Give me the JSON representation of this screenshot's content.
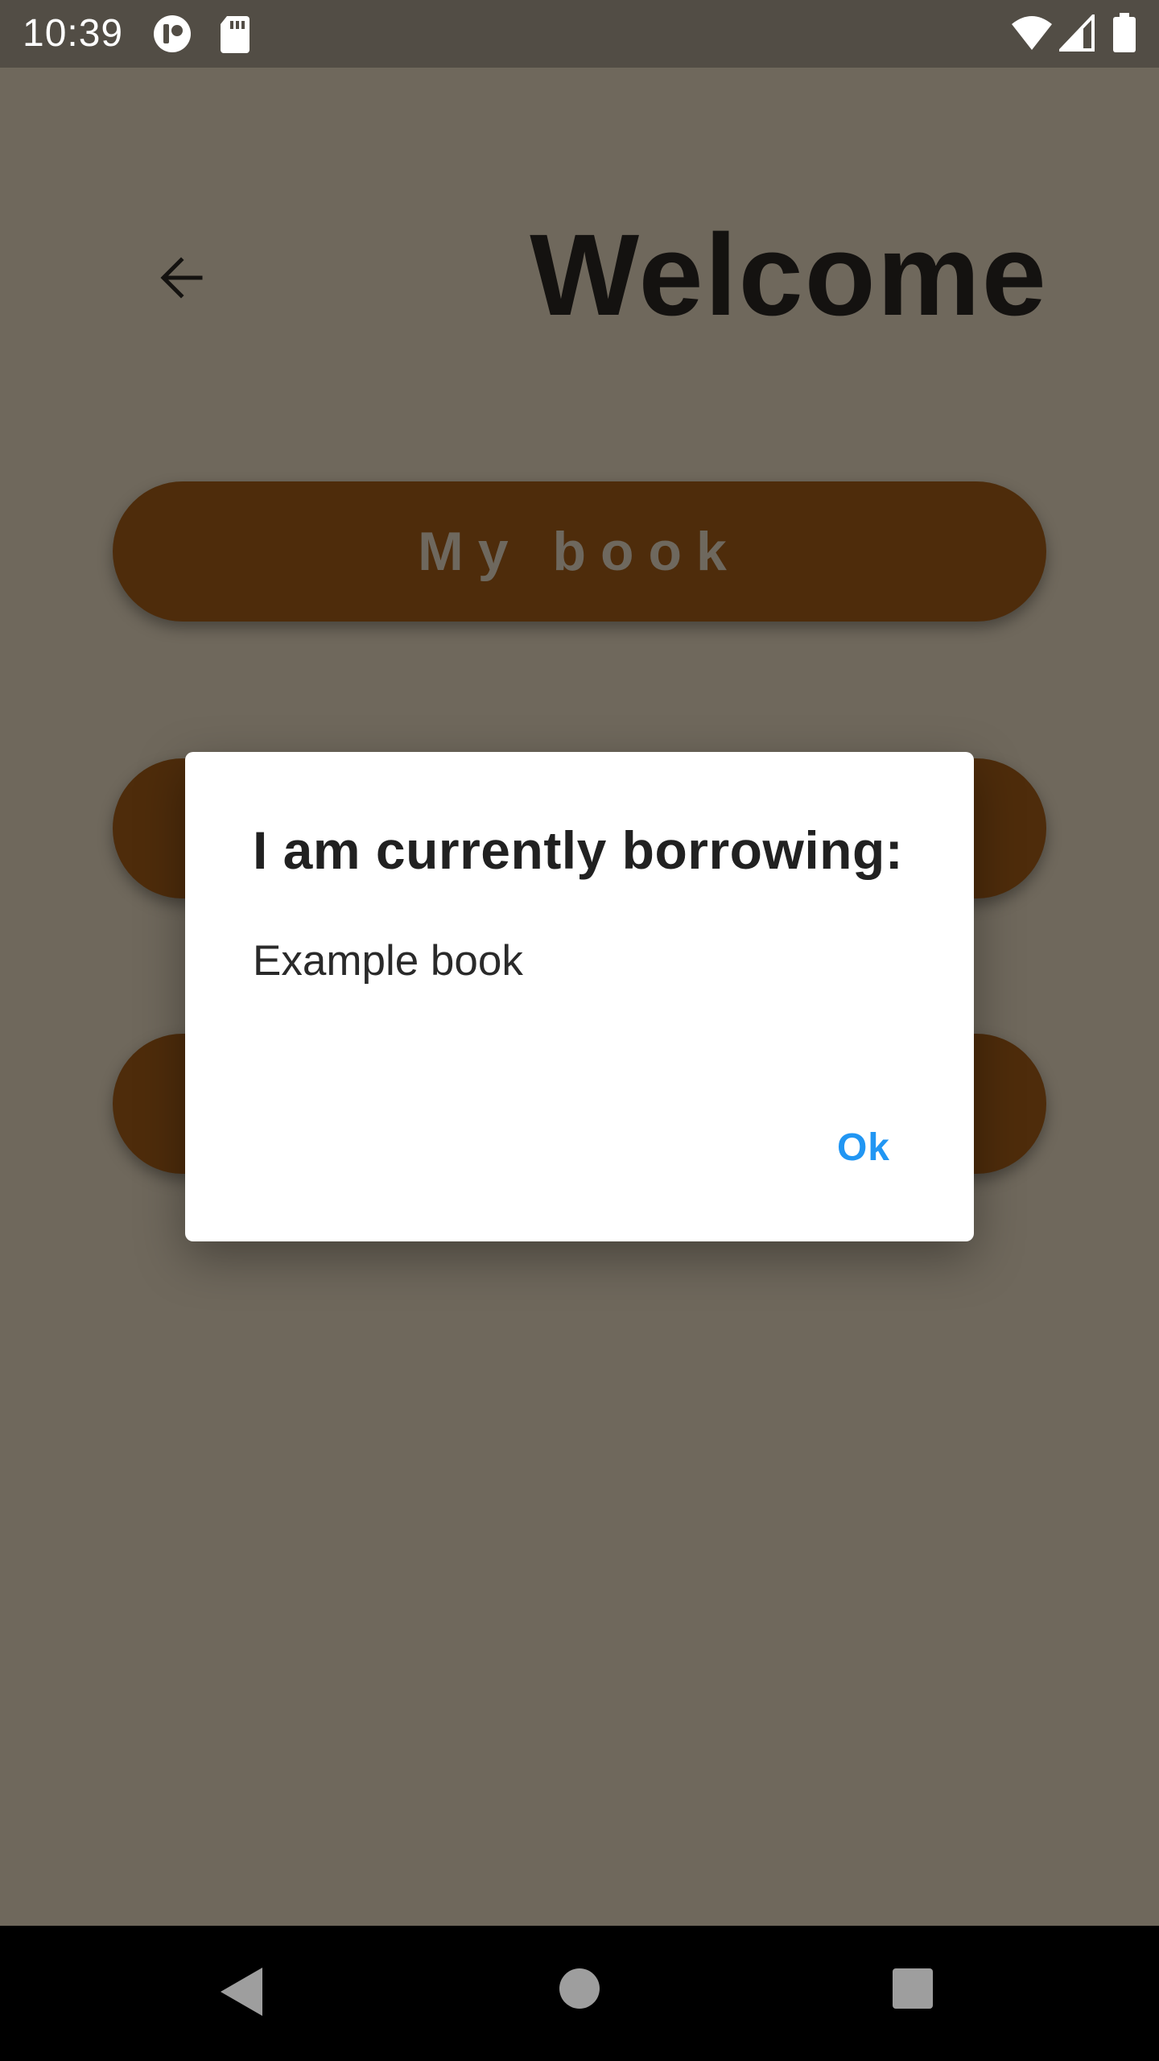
{
  "status_bar": {
    "time": "10:39",
    "icons": [
      "app-notification-icon",
      "sd-card-icon",
      "wifi-icon",
      "cellular-signal-icon",
      "battery-icon"
    ]
  },
  "header": {
    "back_icon": "arrow-back-icon",
    "title": "Welcome"
  },
  "menu": {
    "items": [
      {
        "label": "My book"
      },
      {
        "label": ""
      },
      {
        "label": ""
      }
    ]
  },
  "dialog": {
    "title": "I am currently borrowing:",
    "body": "Example book",
    "ok_label": "Ok"
  },
  "nav_bar": {
    "icons": [
      "nav-back-icon",
      "nav-home-icon",
      "nav-recents-icon"
    ]
  },
  "colors": {
    "scrim_background": "#6f685c",
    "button_brown": "#4e2c0b",
    "accent_blue": "#2196f3",
    "status_bar": "#524d45",
    "nav_bar": "#000000"
  }
}
